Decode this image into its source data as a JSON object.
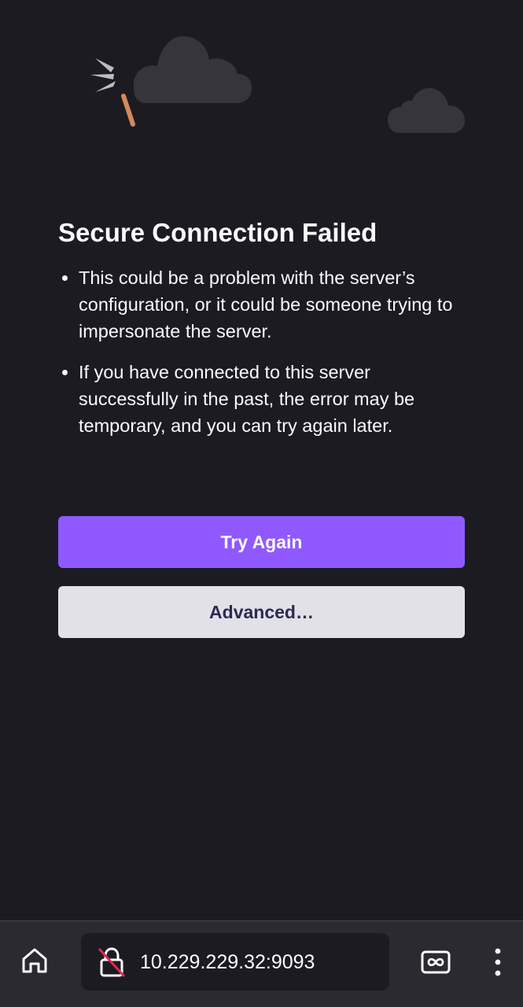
{
  "error": {
    "title": "Secure Connection Failed",
    "bullets": [
      "This could be a problem with the server’s configuration, or it could be someone trying to impersonate the server.",
      "If you have connected to this server successfully in the past, the error may be temporary, and you can try again later."
    ],
    "try_again_label": "Try Again",
    "advanced_label": "Advanced…"
  },
  "toolbar": {
    "url": "10.229.229.32:9093",
    "home_icon": "home-icon",
    "security_icon": "broken-lock-icon",
    "tabs_icon": "infinity-tabs-icon",
    "menu_icon": "kebab-menu-icon"
  },
  "colors": {
    "background": "#1c1b22",
    "primary_button": "#9059ff",
    "secondary_button": "#e2e1e8",
    "toolbar": "#2b2a33"
  }
}
